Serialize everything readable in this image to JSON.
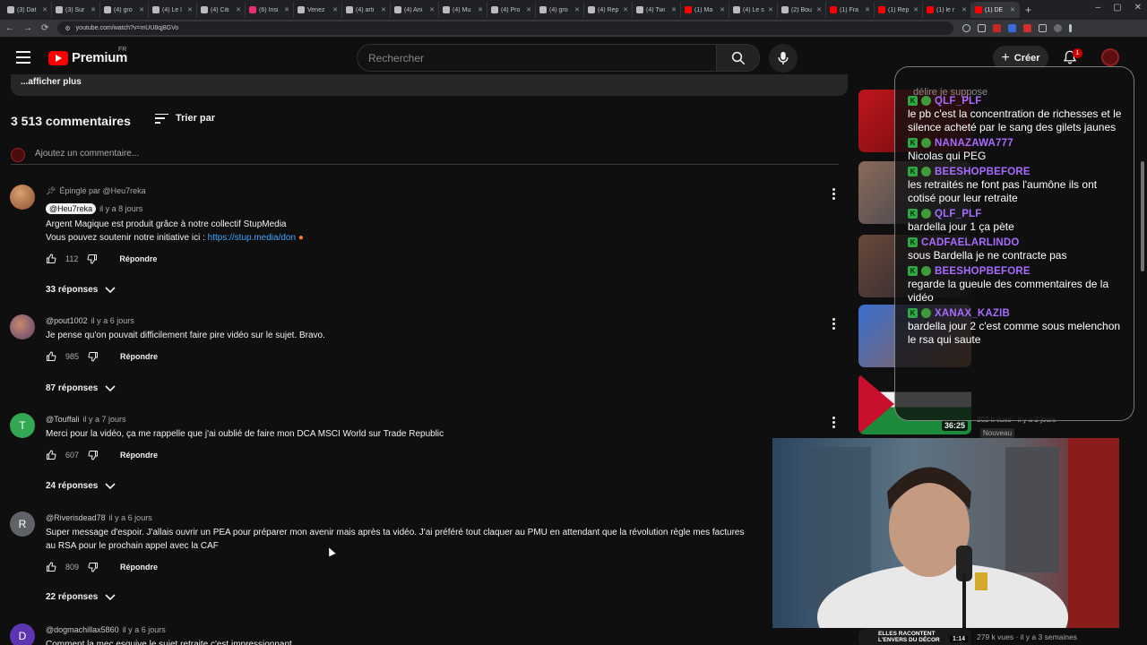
{
  "browser": {
    "tabs": [
      {
        "title": "(3) Dat"
      },
      {
        "title": "(3) Sur"
      },
      {
        "title": "(4) gro"
      },
      {
        "title": "(4) Le l"
      },
      {
        "title": "(4) Citi"
      },
      {
        "title": "(6) Insi"
      },
      {
        "title": "Venez"
      },
      {
        "title": "(4) arti"
      },
      {
        "title": "(4) Ani"
      },
      {
        "title": "(4) Mu"
      },
      {
        "title": "(4) Pro"
      },
      {
        "title": "(4) gro"
      },
      {
        "title": "(4) Rep"
      },
      {
        "title": "(4) Twi"
      },
      {
        "title": "(1) Ma"
      },
      {
        "title": "(4) Le s"
      },
      {
        "title": "(2) Bou"
      },
      {
        "title": "(1) Fra"
      },
      {
        "title": "(1) Rep"
      },
      {
        "title": "(1) le r"
      },
      {
        "title": "(1) DE"
      }
    ],
    "url": "youtube.com/watch?v=mUU8qj8GVo"
  },
  "header": {
    "logo_text": "Premium",
    "region": "FR",
    "search_placeholder": "Rechercher",
    "create_label": "Créer",
    "notifications_count": "1"
  },
  "description": {
    "show_more": "...afficher plus"
  },
  "comments": {
    "count_label": "3 513 commentaires",
    "sort_label": "Trier par",
    "add_placeholder": "Ajoutez un commentaire...",
    "threads": [
      {
        "pinned": "Épinglé par @Heu7reka",
        "author": "@Heu7reka",
        "time": "il y a 8 jours",
        "line1": "Argent Magique est produit grâce à notre collectif StupMedia",
        "line2": "Vous pouvez soutenir notre initiative ici : ",
        "link": "https://stup.media/don",
        "likes": "112",
        "reply": "Répondre",
        "replies": "33 réponses"
      },
      {
        "author": "@pout1002",
        "time": "il y a 6 jours",
        "line1": "Je pense qu'on pouvait difficilement faire pire vidéo sur le sujet. Bravo.",
        "likes": "985",
        "reply": "Répondre",
        "replies": "87 réponses"
      },
      {
        "initial": "T",
        "author": "@Touffali",
        "time": "il y a 7 jours",
        "line1": "Merci pour la vidéo, ça me rappelle que j'ai oublié de faire mon DCA MSCI World sur Trade Republic",
        "likes": "607",
        "reply": "Répondre",
        "replies": "24 réponses"
      },
      {
        "initial": "R",
        "author": "@Riverisdead78",
        "time": "il y a 6 jours",
        "line1": "Super message d'espoir. J'allais ouvrir un PEA pour préparer mon avenir mais après ta vidéo. J'ai préféré tout claquer au PMU en attendant que la révolution règle mes factures",
        "line2": "au RSA pour le prochain appel avec la CAF",
        "likes": "809",
        "reply": "Répondre",
        "replies": "22 réponses"
      },
      {
        "initial": "D",
        "author": "@dogmachillax5860",
        "time": "il y a 6 jours",
        "line1": "Comment la mec esquive le sujet retraite c'est impressionnant"
      }
    ]
  },
  "chat": {
    "ghost_text": "délire je suppose",
    "messages": [
      {
        "user": "QLF_PLF",
        "text": "le pb c'est la concentration de richesses et le silence acheté par le sang des gilets jaunes"
      },
      {
        "user": "NANAZAWA777",
        "text": "Nicolas qui PEG"
      },
      {
        "user": "BEESHOPBEFORE",
        "text": "les retraités ne font pas l'aumône ils ont cotisé pour leur retraite"
      },
      {
        "user": "QLF_PLF",
        "text": "bardella jour 1 ça pète"
      },
      {
        "user": "CADFAELARLINDO",
        "text": "sous Bardella je ne contracte pas"
      },
      {
        "user": "BEESHOPBEFORE",
        "text": "regarde la gueule des commentaires de la vidéo"
      },
      {
        "user": "XANAX_KAZIB",
        "text": "bardella jour 2 c'est comme sous melenchon le rsa qui saute"
      }
    ]
  },
  "sidebar": {
    "duration": "36:25",
    "meta_line": "302 k vues · il y a 2 jours",
    "badge": "Nouveau",
    "bottom_title": "ELLES RACONTENT L'ENVERS DU DÉCOR",
    "bottom_duration": "1:14",
    "bottom_meta": "279 k vues · il y a 3 semaines"
  },
  "colors": {
    "link": "#3ea6ff",
    "chat_username": "#a86bff",
    "brand_red": "#ff0000"
  }
}
